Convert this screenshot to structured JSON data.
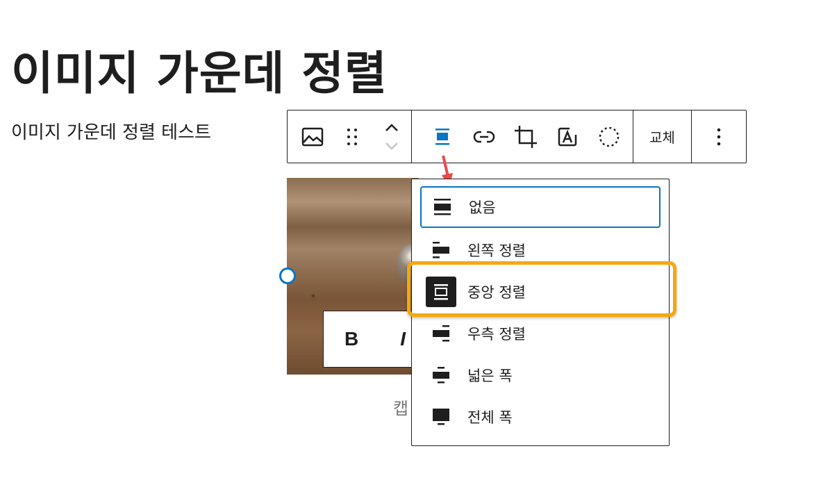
{
  "page": {
    "title": "이미지 가운데 정렬",
    "paragraph": "이미지 가운데 정렬 테스트"
  },
  "toolbar": {
    "icons": [
      "image-icon",
      "drag-handle-icon",
      "move-up-icon",
      "move-down-icon",
      "align-icon",
      "link-icon",
      "crop-icon",
      "text-overlay-icon",
      "dashed-circle-icon",
      "more-options-icon"
    ],
    "replace_label": "교체",
    "accent_color": "#0675c4"
  },
  "image": {
    "format_bold": "B",
    "format_italic": "I",
    "caption_placeholder": "캡"
  },
  "alignment_menu": {
    "items": [
      {
        "label": "없음",
        "icon": "align-none-icon"
      },
      {
        "label": "왼쪽 정렬",
        "icon": "align-left-icon"
      },
      {
        "label": "중앙 정렬",
        "icon": "align-center-icon"
      },
      {
        "label": "우측 정렬",
        "icon": "align-right-icon"
      },
      {
        "label": "넓은 폭",
        "icon": "align-wide-icon"
      },
      {
        "label": "전체 폭",
        "icon": "align-full-icon"
      }
    ],
    "focused_item": "없음",
    "selected_item": "중앙 정렬",
    "highlight_color": "#f5a80c",
    "arrow_color": "#e84a4a"
  }
}
